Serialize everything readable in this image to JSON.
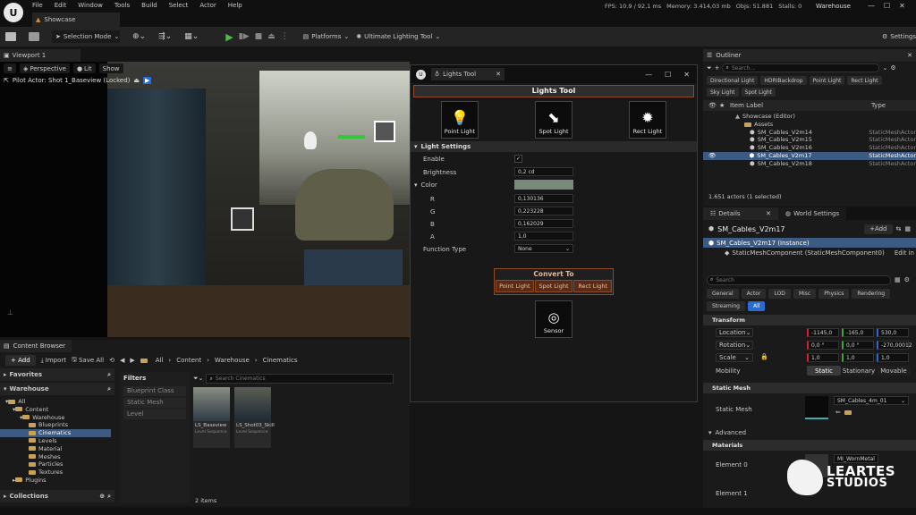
{
  "menu": {
    "items": [
      "File",
      "Edit",
      "Window",
      "Tools",
      "Build",
      "Select",
      "Actor",
      "Help"
    ]
  },
  "stats": {
    "fps": "FPS: 10.9 / 92,1 ms",
    "memory": "Memory: 3.414,03 mb",
    "objs": "Objs: 51.881",
    "stalls": "Stalls: 0",
    "project": "Warehouse"
  },
  "doc_tab": "Showcase",
  "toolbar": {
    "selection_mode": "Selection Mode",
    "platforms": "Platforms",
    "plugin": "Ultimate Lighting Tool",
    "settings": "Settings"
  },
  "viewport": {
    "tab": "Viewport 1",
    "perspective": "Perspective",
    "lit": "Lit",
    "show": "Show",
    "pilot": "Pilot Actor: Shot 1_Baseview (Locked)"
  },
  "lights_tool": {
    "window_title": "Lights Tool",
    "header": "Lights Tool",
    "buttons": [
      "Point Light",
      "Spot Light",
      "Rect Light"
    ],
    "section": "Light Settings",
    "enable_label": "Enable",
    "brightness_label": "Brightness",
    "brightness_value": "0,2 cd",
    "color_label": "Color",
    "color_swatch": "#7a8a7a",
    "r_label": "R",
    "r_value": "0,130136",
    "g_label": "G",
    "g_value": "0,223228",
    "b_label": "B",
    "b_value": "0,162029",
    "a_label": "A",
    "a_value": "1,0",
    "function_label": "Function Type",
    "function_value": "None",
    "convert_to": "Convert To",
    "convert_buttons": [
      "Point Light",
      "Spot Light",
      "Rect Light"
    ],
    "sensor": "Sensor"
  },
  "outliner": {
    "title": "Outliner",
    "search_placeholder": "Search...",
    "filters": [
      "Directional Light",
      "HDRIBackdrop",
      "Point Light",
      "Rect Light",
      "Sky Light",
      "Spot Light"
    ],
    "col_label": "Item Label",
    "col_type": "Type",
    "rows": [
      {
        "label": "Showcase (Editor)",
        "type": ""
      },
      {
        "label": "Assets",
        "type": ""
      },
      {
        "label": "SM_Cables_V2m14",
        "type": "StaticMeshActor"
      },
      {
        "label": "SM_Cables_V2m15",
        "type": "StaticMeshActor"
      },
      {
        "label": "SM_Cables_V2m16",
        "type": "StaticMeshActor"
      },
      {
        "label": "SM_Cables_V2m17",
        "type": "StaticMeshActor"
      },
      {
        "label": "SM_Cables_V2m18",
        "type": "StaticMeshActor"
      }
    ],
    "count": "1.651 actors (1 selected)"
  },
  "details": {
    "tab1": "Details",
    "tab2": "World Settings",
    "object": "SM_Cables_V2m17",
    "add": "+Add",
    "instance": "SM_Cables_V2m17 (Instance)",
    "component": "StaticMeshComponent (StaticMeshComponent0)",
    "edit_in": "Edit in",
    "search_placeholder": "Search",
    "filters": [
      "General",
      "Actor",
      "LOD",
      "Misc",
      "Physics",
      "Rendering",
      "Streaming",
      "All"
    ],
    "transform": "Transform",
    "location": "Location",
    "loc": [
      "-1145,0",
      "-165,0",
      "530,0"
    ],
    "rotation": "Rotation",
    "rot": [
      "0,0 °",
      "0,0 °",
      "-270,00012"
    ],
    "scale": "Scale",
    "scl": [
      "1,0",
      "1,0",
      "1,0"
    ],
    "mobility": "Mobility",
    "mobility_opts": [
      "Static",
      "Stationary",
      "Movable"
    ],
    "static_mesh_sec": "Static Mesh",
    "static_mesh_label": "Static Mesh",
    "static_mesh_value": "SM_Cables_4m_01",
    "advanced": "Advanced",
    "materials": "Materials",
    "element0": "Element 0",
    "element0_value": "MI_WornMetal",
    "element1": "Element 1"
  },
  "content_browser": {
    "title": "Content Browser",
    "add": "+ Add",
    "import": "Import",
    "save_all": "Save All",
    "path": [
      "All",
      "Content",
      "Warehouse",
      "Cinematics"
    ],
    "favorites": "Favorites",
    "warehouse": "Warehouse",
    "tree": [
      "All",
      "Content",
      "Warehouse",
      "Blueprints",
      "Cinematics",
      "Levels",
      "Material",
      "Meshes",
      "Particles",
      "Textures",
      "Plugins"
    ],
    "collections": "Collections",
    "filters_title": "Filters",
    "filter_items": [
      "Blueprint Class",
      "Static Mesh",
      "Level"
    ],
    "search_placeholder": "Search Cinematics",
    "assets": [
      {
        "name": "LS_Baseview",
        "type": "Level Sequence"
      },
      {
        "name": "LS_Shot03_Skill",
        "type": "Level Sequence"
      }
    ],
    "count": "2 items"
  },
  "watermark": {
    "line1": "LEARTES",
    "line2": "STUDIOS"
  }
}
